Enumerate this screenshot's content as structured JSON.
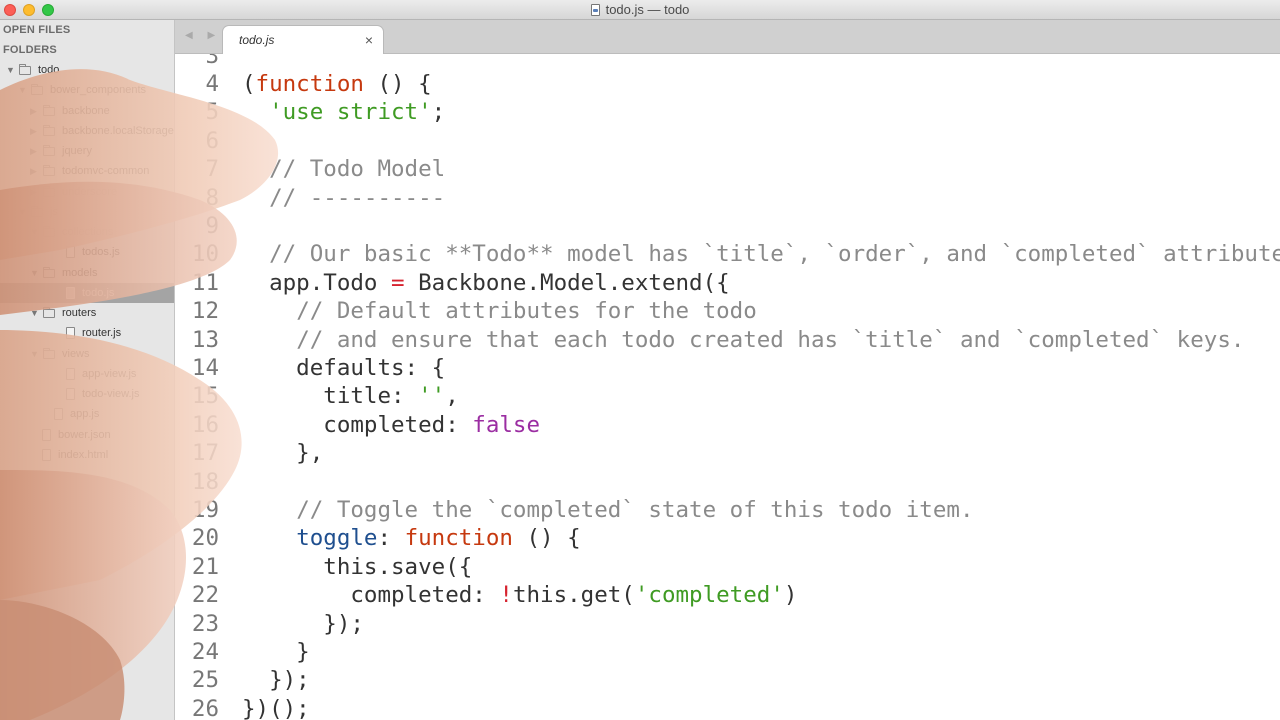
{
  "window": {
    "title": "todo.js — todo"
  },
  "sidebar": {
    "open_files_header": "OPEN FILES",
    "folders_header": "FOLDERS",
    "tree": [
      {
        "label": "todo",
        "kind": "folder",
        "depth": 0,
        "expanded": true
      },
      {
        "label": "bower_components",
        "kind": "folder",
        "depth": 1,
        "expanded": true
      },
      {
        "label": "backbone",
        "kind": "folder",
        "depth": 2,
        "expanded": false
      },
      {
        "label": "backbone.localStorage",
        "kind": "folder",
        "depth": 2,
        "expanded": false
      },
      {
        "label": "jquery",
        "kind": "folder",
        "depth": 2,
        "expanded": false
      },
      {
        "label": "todomvc-common",
        "kind": "folder",
        "depth": 2,
        "expanded": false
      },
      {
        "label": "underscore",
        "kind": "folder",
        "depth": 2,
        "expanded": false
      },
      {
        "label": "js",
        "kind": "folder",
        "depth": 1,
        "expanded": true
      },
      {
        "label": "collections",
        "kind": "folder",
        "depth": 2,
        "expanded": true
      },
      {
        "label": "todos.js",
        "kind": "file",
        "depth": 3
      },
      {
        "label": "models",
        "kind": "folder",
        "depth": 2,
        "expanded": true
      },
      {
        "label": "todo.js",
        "kind": "file",
        "depth": 3,
        "selected": true
      },
      {
        "label": "routers",
        "kind": "folder",
        "depth": 2,
        "expanded": true
      },
      {
        "label": "router.js",
        "kind": "file",
        "depth": 3
      },
      {
        "label": "views",
        "kind": "folder",
        "depth": 2,
        "expanded": true
      },
      {
        "label": "app-view.js",
        "kind": "file",
        "depth": 3
      },
      {
        "label": "todo-view.js",
        "kind": "file",
        "depth": 3
      },
      {
        "label": "app.js",
        "kind": "file",
        "depth": 2
      },
      {
        "label": "bower.json",
        "kind": "file",
        "depth": 1
      },
      {
        "label": "index.html",
        "kind": "file",
        "depth": 1
      }
    ]
  },
  "tabs": [
    {
      "label": "todo.js",
      "active": true,
      "close_glyph": "×"
    }
  ],
  "editor": {
    "lines": [
      {
        "num": "3",
        "tokens": []
      },
      {
        "num": "4",
        "tokens": [
          [
            "plain",
            "("
          ],
          [
            "kw",
            "function"
          ],
          [
            "plain",
            " () {"
          ]
        ]
      },
      {
        "num": "5",
        "tokens": [
          [
            "plain",
            "  "
          ],
          [
            "str",
            "'use strict'"
          ],
          [
            "plain",
            ";"
          ]
        ]
      },
      {
        "num": "6",
        "tokens": []
      },
      {
        "num": "7",
        "tokens": [
          [
            "plain",
            "  "
          ],
          [
            "comment",
            "// Todo Model"
          ]
        ]
      },
      {
        "num": "8",
        "tokens": [
          [
            "plain",
            "  "
          ],
          [
            "comment",
            "// ----------"
          ]
        ]
      },
      {
        "num": "9",
        "tokens": []
      },
      {
        "num": "10",
        "tokens": [
          [
            "plain",
            "  "
          ],
          [
            "comment",
            "// Our basic **Todo** model has `title`, `order`, and `completed` attributes."
          ]
        ]
      },
      {
        "num": "11",
        "tokens": [
          [
            "plain",
            "  app.Todo "
          ],
          [
            "op",
            "="
          ],
          [
            "plain",
            " Backbone.Model.extend({"
          ]
        ]
      },
      {
        "num": "12",
        "tokens": [
          [
            "plain",
            "    "
          ],
          [
            "comment",
            "// Default attributes for the todo"
          ]
        ]
      },
      {
        "num": "13",
        "tokens": [
          [
            "plain",
            "    "
          ],
          [
            "comment",
            "// and ensure that each todo created has `title` and `completed` keys."
          ]
        ]
      },
      {
        "num": "14",
        "tokens": [
          [
            "plain",
            "    defaults: {"
          ]
        ]
      },
      {
        "num": "15",
        "tokens": [
          [
            "plain",
            "      title: "
          ],
          [
            "str",
            "''"
          ],
          [
            "plain",
            ","
          ]
        ]
      },
      {
        "num": "16",
        "tokens": [
          [
            "plain",
            "      completed: "
          ],
          [
            "const",
            "false"
          ]
        ]
      },
      {
        "num": "17",
        "tokens": [
          [
            "plain",
            "    },"
          ]
        ]
      },
      {
        "num": "18",
        "tokens": []
      },
      {
        "num": "19",
        "tokens": [
          [
            "plain",
            "    "
          ],
          [
            "comment",
            "// Toggle the `completed` state of this todo item."
          ]
        ]
      },
      {
        "num": "20",
        "tokens": [
          [
            "plain",
            "    "
          ],
          [
            "fn",
            "toggle"
          ],
          [
            "plain",
            ": "
          ],
          [
            "kw",
            "function"
          ],
          [
            "plain",
            " () {"
          ]
        ]
      },
      {
        "num": "21",
        "tokens": [
          [
            "plain",
            "      this.save({"
          ]
        ]
      },
      {
        "num": "22",
        "tokens": [
          [
            "plain",
            "        completed: "
          ],
          [
            "op",
            "!"
          ],
          [
            "plain",
            "this.get("
          ],
          [
            "str",
            "'completed'"
          ],
          [
            "plain",
            ")"
          ]
        ]
      },
      {
        "num": "23",
        "tokens": [
          [
            "plain",
            "      });"
          ]
        ]
      },
      {
        "num": "24",
        "tokens": [
          [
            "plain",
            "    }"
          ]
        ]
      },
      {
        "num": "25",
        "tokens": [
          [
            "plain",
            "  });"
          ]
        ]
      },
      {
        "num": "26",
        "tokens": [
          [
            "plain",
            "})();"
          ]
        ]
      }
    ]
  },
  "colors": {
    "keyword": "#c6390f",
    "string": "#3f9b23",
    "comment": "#8a8a8a",
    "operator": "#d6232f",
    "constant": "#9b2ea2",
    "function_name": "#1f4f8f",
    "sidebar_bg": "#e6e6e6",
    "sidebar_selected": "#a4a4a4"
  },
  "icons": {
    "folder": "folder-icon",
    "file": "file-icon",
    "disclosure_open": "▼",
    "disclosure_closed": "▶",
    "nav_back_forward": "◀ ▶"
  }
}
